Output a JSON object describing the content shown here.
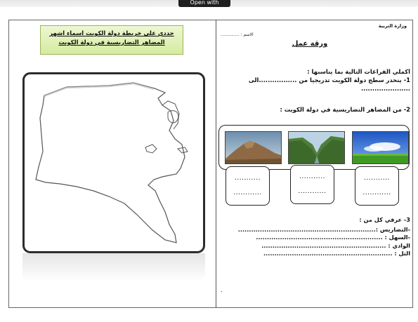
{
  "viewer": {
    "open_with_label": "Open with"
  },
  "worksheet": {
    "ministry": "وزارة التربية",
    "name_label": "الاسم : ..............",
    "title": "ورقة عمل",
    "q1_intro": "اكملي الفراغات التالية بما يناسبها :",
    "q1_line": "1- ينحدر سطح دولة الكويت تدريجيا من .................الى",
    "q1_blank": "......................",
    "q2_title": "2- من المضاهر التضاريسية في دولة الكويت :",
    "photos": [
      {
        "icon": "plain-photo-icon",
        "blank1": "...........",
        "blank2": "............"
      },
      {
        "icon": "valley-photo-icon",
        "blank1": "...........",
        "blank2": "............"
      },
      {
        "icon": "mountain-photo-icon",
        "blank1": "...........",
        "blank2": "............"
      }
    ],
    "q3_title": "3- عرفي كل من :",
    "q3_items": [
      "-التضاريس :...............................................................",
      "-السهل : ..........................................................",
      "الوادي : .........................................................",
      "التل : ..........................................................."
    ],
    "footer_dot": "."
  },
  "map_section": {
    "instruction_line1": "حددي على خريطة دولة الكويت اسماء اشهر",
    "instruction_line2": "المضاهر التضاريسية في دولة الكويت",
    "map_icon": "kuwait-outline-map-icon"
  },
  "colors": {
    "instruction_bg": "#dbeeac",
    "frame": "#2c2c2c"
  }
}
